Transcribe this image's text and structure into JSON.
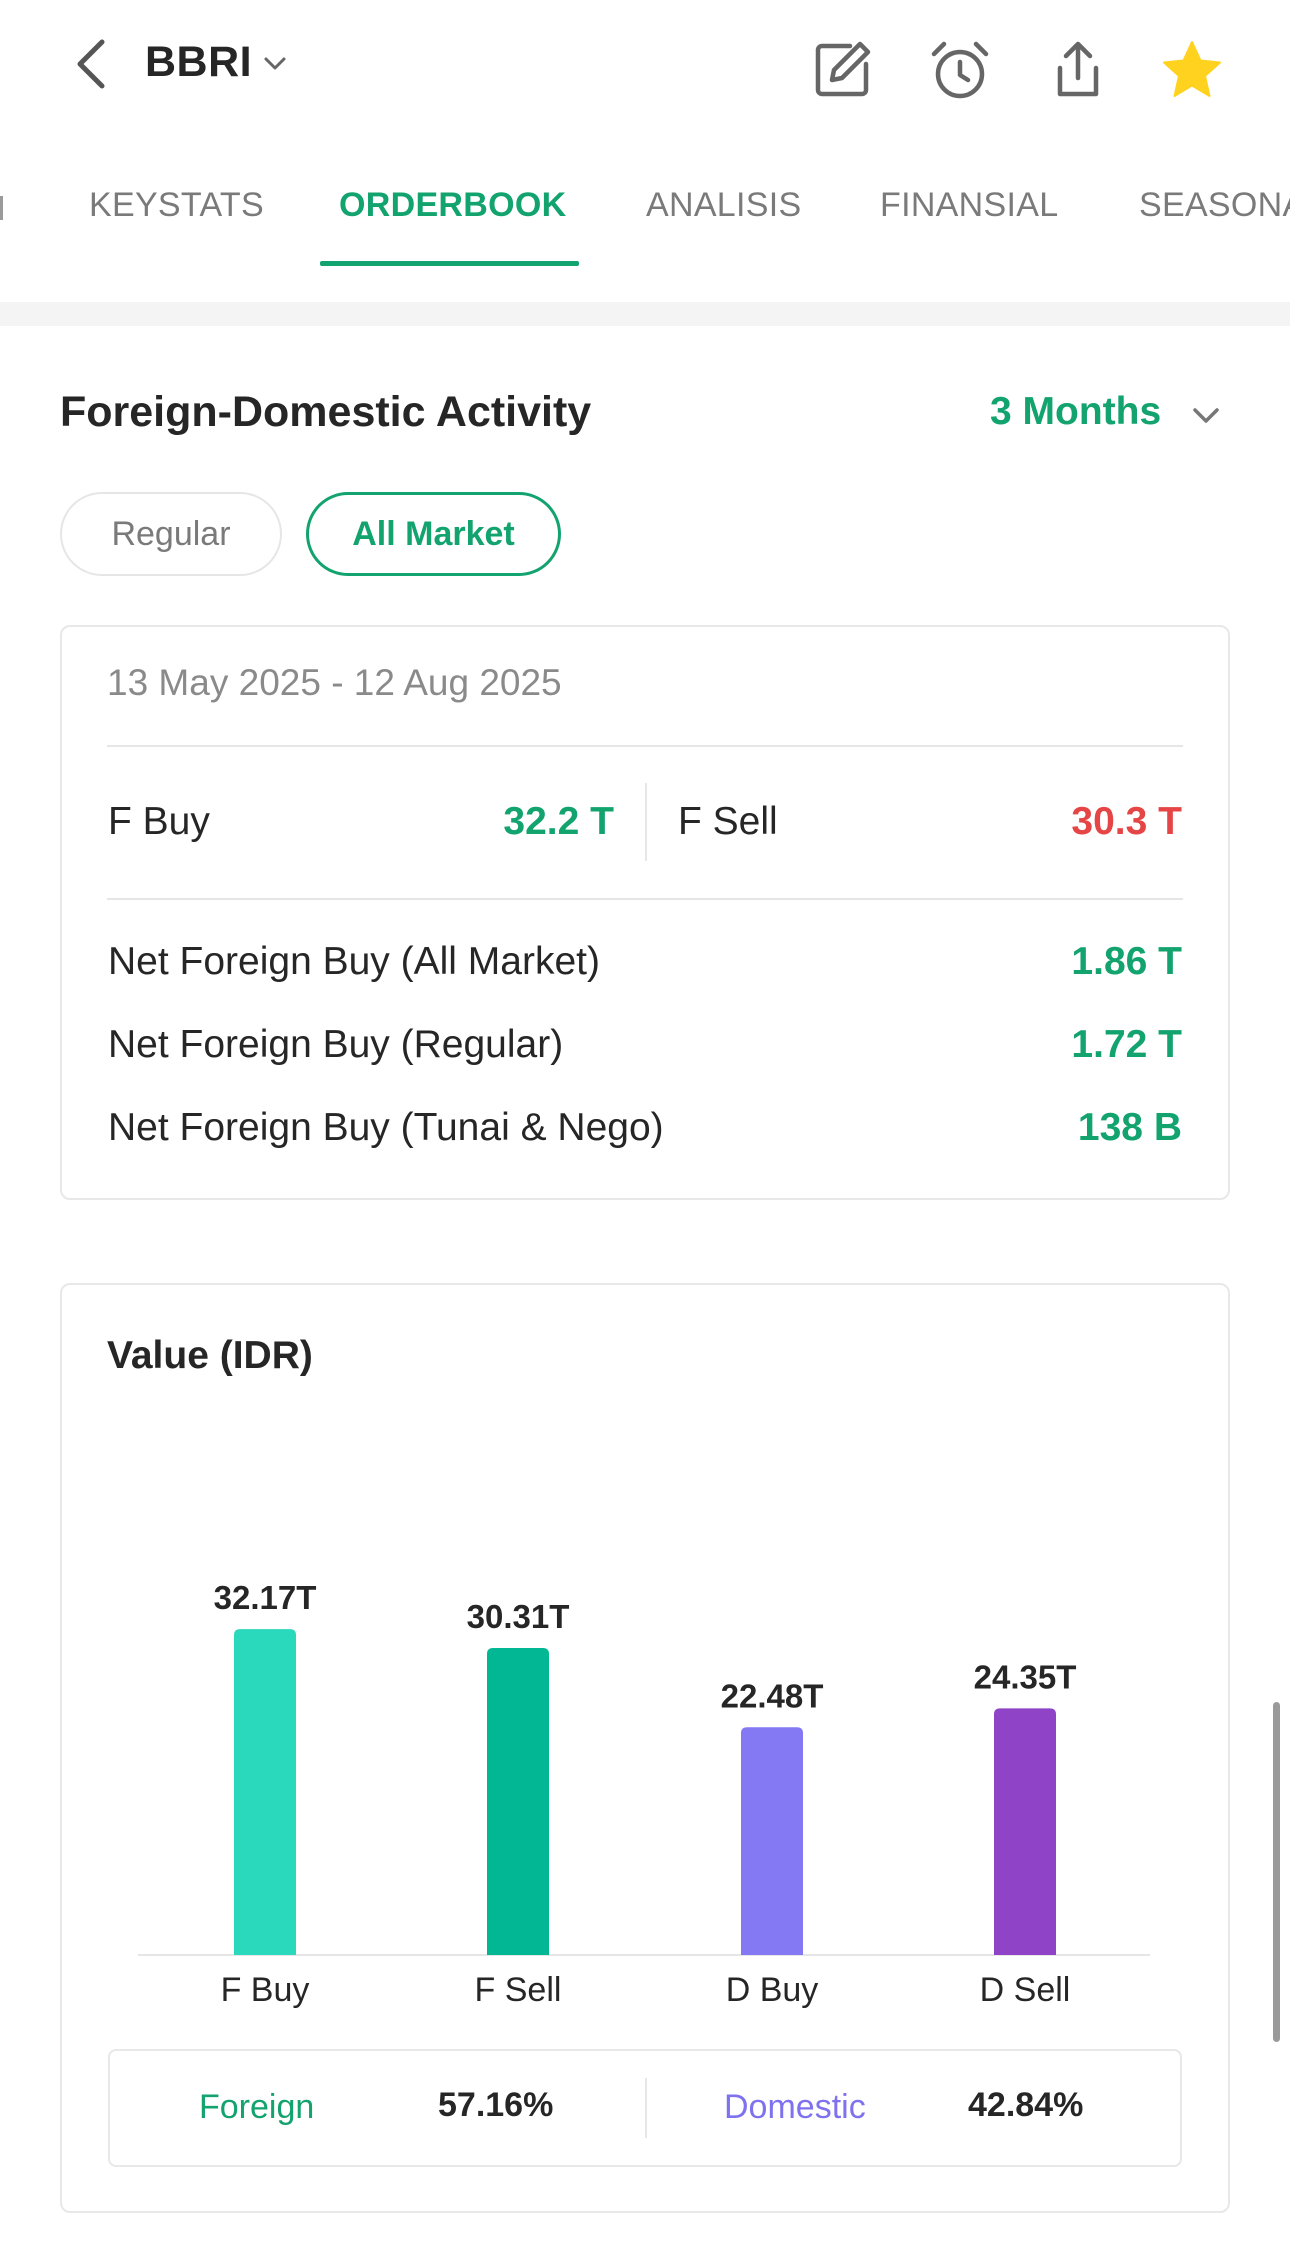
{
  "header": {
    "ticker": "BBRI"
  },
  "tabs": [
    {
      "label": "KEYSTATS",
      "active": false
    },
    {
      "label": "ORDERBOOK",
      "active": true
    },
    {
      "label": "ANALISIS",
      "active": false
    },
    {
      "label": "FINANSIAL",
      "active": false
    },
    {
      "label": "SEASONA",
      "active": false
    }
  ],
  "section": {
    "title": "Foreign-Domestic Activity",
    "period": "3 Months",
    "toggle": {
      "regular": "Regular",
      "all_market": "All Market",
      "selected": "All Market"
    }
  },
  "summary": {
    "date_range": "13 May 2025 - 12 Aug 2025",
    "f_buy_label": "F Buy",
    "f_buy_value": "32.2 T",
    "f_sell_label": "F Sell",
    "f_sell_value": "30.3 T",
    "net_rows": [
      {
        "label": "Net Foreign Buy (All Market)",
        "value": "1.86 T"
      },
      {
        "label": "Net Foreign Buy (Regular)",
        "value": "1.72 T"
      },
      {
        "label": "Net Foreign Buy (Tunai & Nego)",
        "value": "138 B"
      }
    ]
  },
  "chart_data": {
    "type": "bar",
    "title": "Value (IDR)",
    "categories": [
      "F Buy",
      "F Sell",
      "D Buy",
      "D Sell"
    ],
    "values": [
      32.17,
      30.31,
      22.48,
      24.35
    ],
    "value_labels": [
      "32.17T",
      "30.31T",
      "22.48T",
      "24.35T"
    ],
    "ylim": [
      0,
      40
    ],
    "grid": false,
    "colors": [
      "#2ad8bb",
      "#02b894",
      "#8479f3",
      "#8f44c8"
    ]
  },
  "composition": {
    "foreign_label": "Foreign",
    "foreign_value": "57.16%",
    "domestic_label": "Domestic",
    "domestic_value": "42.84%"
  },
  "colors": {
    "accent_green": "#12a36e",
    "sell_red": "#e54545",
    "domestic_purple": "#7f72ee",
    "star_yellow": "#ffd21f"
  },
  "icons": {
    "back": "chevron-left-icon",
    "ticker_dropdown": "chevron-down-icon",
    "edit": "edit-icon",
    "alarm": "alarm-clock-icon",
    "share": "share-icon",
    "watchlist": "star-icon"
  }
}
